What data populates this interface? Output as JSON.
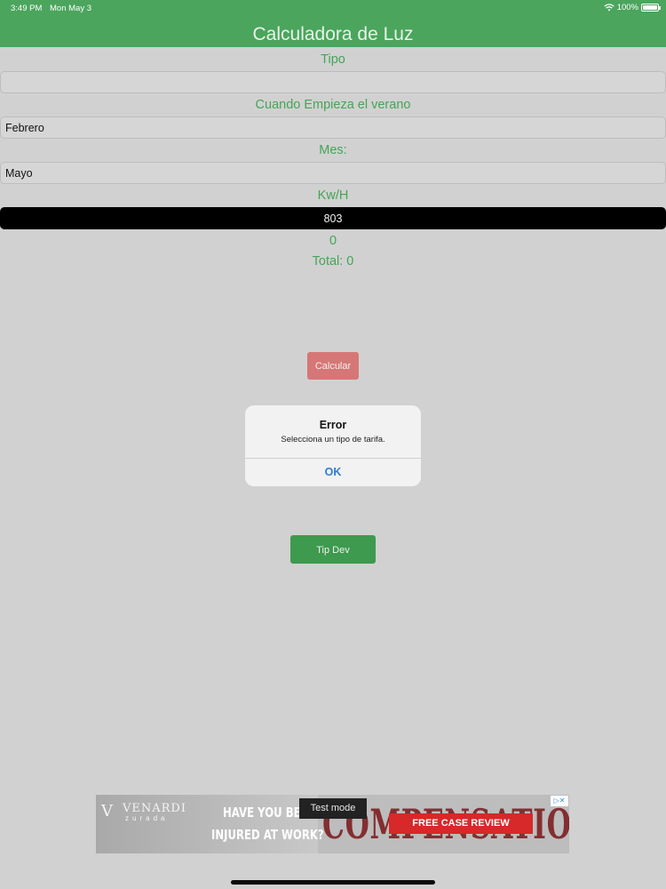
{
  "status_bar": {
    "time": "3:49 PM",
    "date": "Mon May 3",
    "battery": "100%"
  },
  "nav": {
    "title": "Calculadora de Luz"
  },
  "form": {
    "tipo_label": "Tipo",
    "tipo_value": "",
    "verano_label": "Cuando Empieza el verano",
    "verano_value": "Febrero",
    "mes_label": "Mes:",
    "mes_value": "Mayo",
    "kwh_label": "Kw/H",
    "kwh_value": "803",
    "result_value": "0",
    "total_label": "Total: 0"
  },
  "buttons": {
    "calcular": "Calcular",
    "tip_dev": "Tip Dev"
  },
  "alert": {
    "title": "Error",
    "message": "Selecciona un tipo de tarifa.",
    "ok": "OK"
  },
  "ad": {
    "brand_top": "VENARDI",
    "brand_bottom": "zurada",
    "headline_1": "HAVE YOU BE",
    "headline_2": "INJURED AT WORK?",
    "background_word": "COMPENSATION",
    "cta": "FREE CASE REVIEW",
    "test_mode": "Test mode"
  },
  "colors": {
    "primary_green": "#4ba55d",
    "label_green": "#44a556",
    "calc_button": "#d57776",
    "tip_button": "#3d9a4e",
    "alert_ok_blue": "#2e7cd5"
  }
}
